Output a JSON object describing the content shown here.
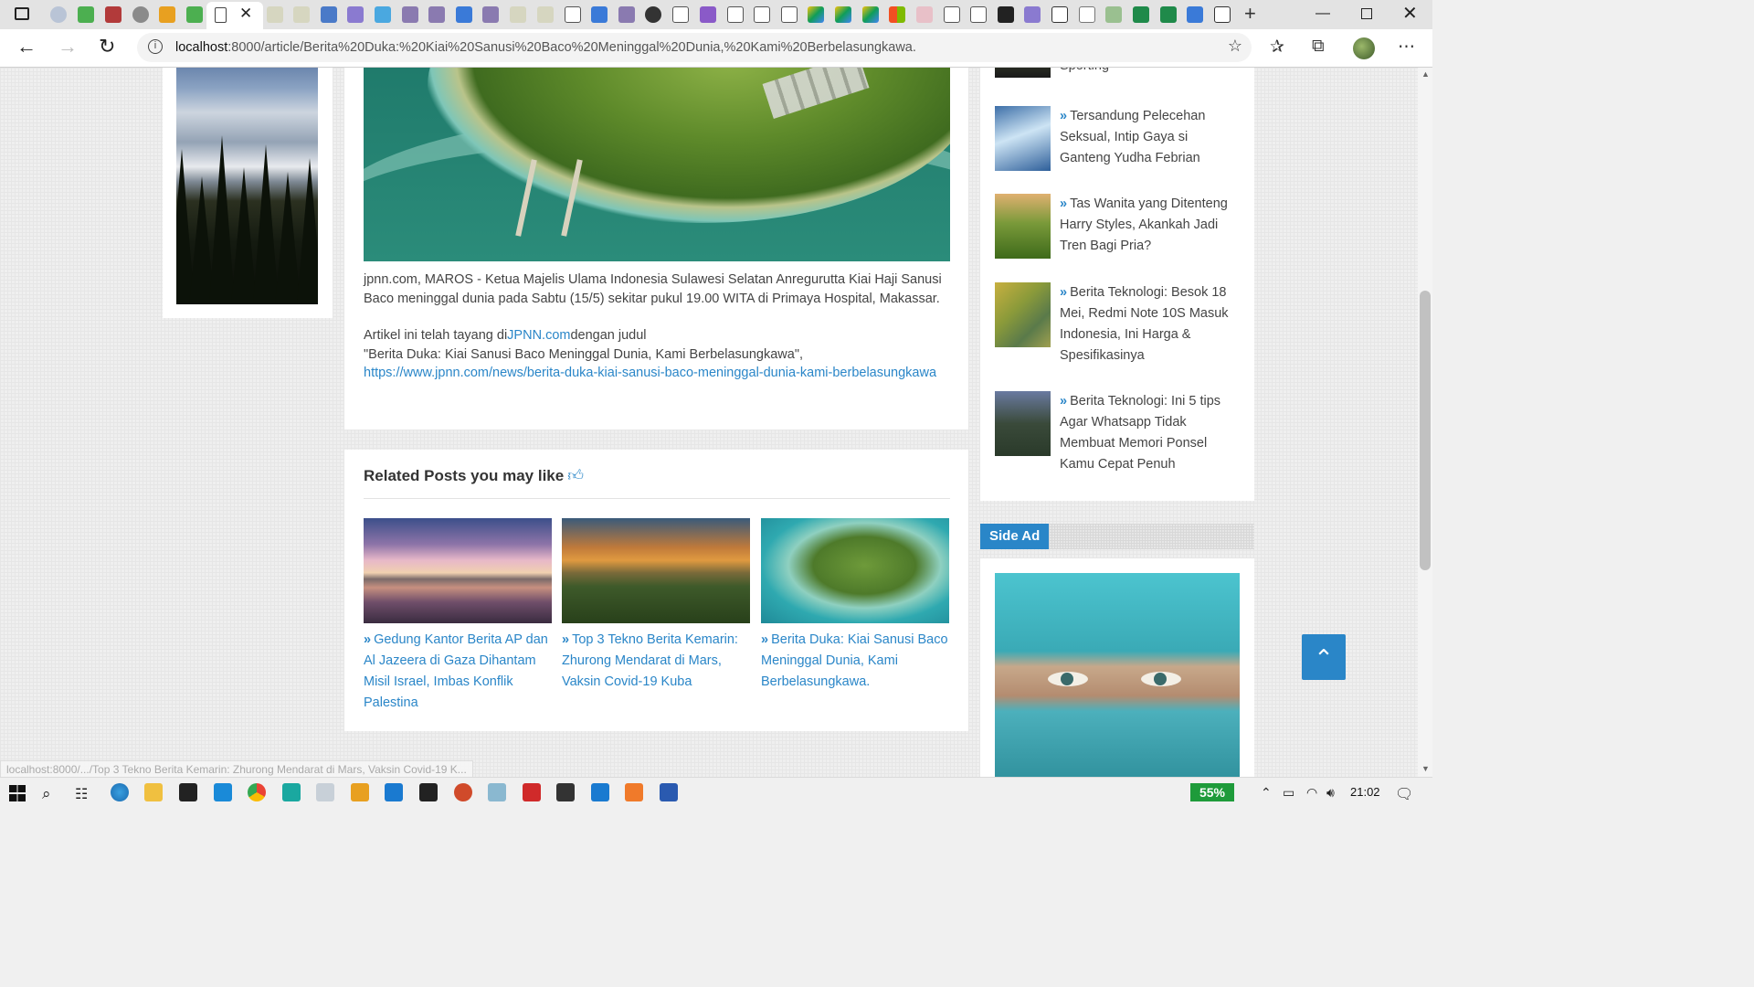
{
  "browser": {
    "url_host": "localhost",
    "url_rest": ":8000/article/Berita%20Duka:%20Kiai%20Sanusi%20Baco%20Meninggal%20Dunia,%20Kami%20Berbelasungkawa.",
    "active_tab_close": "✕",
    "new_tab": "+",
    "status_url": "localhost:8000/.../Top 3 Tekno Berita Kemarin: Zhurong Mendarat di Mars, Vaksin Covid-19 K..."
  },
  "article": {
    "lead": "jpnn.com, MAROS - Ketua Majelis Ulama Indonesia Sulawesi Selatan Anregurutta Kiai Haji Sanusi Baco meninggal dunia pada Sabtu (15/5) sekitar pukul 19.00 WITA di Primaya Hospital, Makassar.",
    "source_prefix": "Artikel ini telah tayang di",
    "source_name": "JPNN.com",
    "source_suffix": "dengan judul",
    "source_title": "\"Berita Duka: Kiai Sanusi Baco Meninggal Dunia, Kami Berbelasungkawa\",",
    "source_link": "https://www.jpnn.com/news/berita-duka-kiai-sanusi-baco-meninggal-dunia-kami-berbelasungkawa"
  },
  "related": {
    "title": "Related Posts you may like",
    "posts": [
      {
        "title": "Gedung Kantor Berita AP dan Al Jazeera di Gaza Dihantam Misil Israel, Imbas Konflik Palestina"
      },
      {
        "title": "Top 3 Tekno Berita Kemarin: Zhurong Mendarat di Mars, Vaksin Covid-19 Kuba"
      },
      {
        "title": "Berita Duka: Kiai Sanusi Baco Meninggal Dunia, Kami Berbelasungkawa."
      }
    ]
  },
  "sidebar": {
    "items": [
      {
        "title": "Sporting"
      },
      {
        "title": "Tersandung Pelecehan Seksual, Intip Gaya si Ganteng Yudha Febrian"
      },
      {
        "title": "Tas Wanita yang Ditenteng Harry Styles, Akankah Jadi Tren Bagi Pria?"
      },
      {
        "title": "Berita Teknologi: Besok 18 Mei, Redmi Note 10S Masuk Indonesia, Ini Harga & Spesifikasinya"
      },
      {
        "title": "Berita Teknologi: Ini 5 tips Agar Whatsapp Tidak Membuat Memori Ponsel Kamu Cepat Penuh"
      }
    ],
    "ad_label": "Side Ad"
  },
  "taskbar": {
    "battery": "55%",
    "clock": "21:02"
  },
  "colors": {
    "accent": "#2a86c8",
    "battery_green": "#1e9b3a"
  }
}
